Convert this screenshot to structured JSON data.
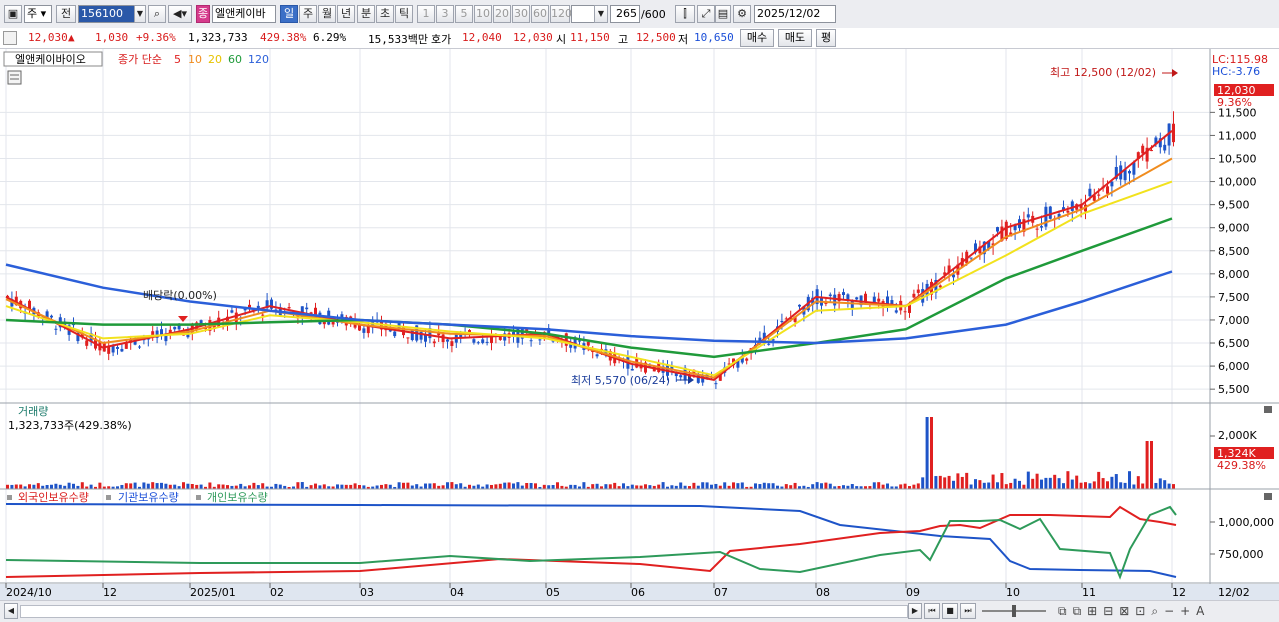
{
  "toolbar": {
    "mode": "주",
    "prev": "전",
    "code": "156100",
    "stock_name": "엘앤케이바",
    "badge": "종",
    "periods": [
      "일",
      "주",
      "월",
      "년",
      "분",
      "초",
      "틱"
    ],
    "selected_period": "일",
    "numbers": [
      "1",
      "3",
      "5",
      "10",
      "20",
      "30",
      "60",
      "120"
    ],
    "count": "265",
    "total": "/600",
    "date": "2025/12/02"
  },
  "quote": {
    "price": "12,030",
    "arrow": "▲",
    "change": "1,030",
    "rate": "+9.36%",
    "volume": "1,323,733",
    "vol_ratio": "429.38%",
    "turnover": "6.29%",
    "amount": "15,533백만",
    "ask_label": "호가",
    "ask": "12,040",
    "bid": "12,030",
    "open_label": "시",
    "open": "11,150",
    "high_label": "고",
    "high": "12,500",
    "low_label": "저",
    "low": "10,650",
    "buy": "매수",
    "sell": "매도",
    "eval": "평"
  },
  "price_panel": {
    "name": "엘앤케이바이오",
    "ma_title": "종가 단순",
    "ma_periods": [
      "5",
      "10",
      "20",
      "60",
      "120"
    ],
    "lc": "LC:115.98",
    "hc": "HC:-3.76",
    "current_price": "12,030",
    "current_rate": "9.36%",
    "high_note": "최고 12,500 (12/02)",
    "low_note": "최저 5,570 (06/24)",
    "dividend_note": "배당락(0.00%)",
    "y_ticks": [
      "11,500",
      "11,000",
      "10,500",
      "10,000",
      "9,500",
      "9,000",
      "8,500",
      "8,000",
      "7,500",
      "7,000",
      "6,500",
      "6,000",
      "5,500"
    ],
    "colors": {
      "ma5": "#e02020",
      "ma10": "#f08c1e",
      "ma20": "#f2e21d",
      "ma60": "#1f9a3a",
      "ma120": "#2b5fd9",
      "up": "#e02020",
      "down": "#1e54c8"
    }
  },
  "volume_panel": {
    "title": "거래량",
    "value": "1,323,733주(429.38%)",
    "tick": "2,000K",
    "current": "1,324K",
    "current_rate": "429.38%"
  },
  "holding_panel": {
    "series": [
      "외국인보유수량",
      "기관보유수량",
      "개인보유수량"
    ],
    "ticks": [
      "1,000,000",
      "750,000"
    ],
    "colors": {
      "foreign": "#e02020",
      "institution": "#1e54c8",
      "individual": "#2e9a5a"
    }
  },
  "x_axis": {
    "labels": [
      "2024/10",
      "12",
      "2025/01",
      "02",
      "03",
      "04",
      "05",
      "06",
      "07",
      "08",
      "09",
      "10",
      "11",
      "12"
    ],
    "right_label": "12/02"
  },
  "chart_data": {
    "type": "line",
    "title": "",
    "x": [
      "2024/10",
      "12",
      "2025/01",
      "02",
      "03",
      "04",
      "05",
      "06",
      "07",
      "08",
      "09",
      "10",
      "11",
      "12"
    ],
    "series": [
      {
        "name": "5",
        "values": [
          7500,
          6400,
          6800,
          7300,
          6900,
          6600,
          6700,
          6050,
          5700,
          7500,
          7300,
          9000,
          9500,
          11100
        ]
      },
      {
        "name": "10",
        "values": [
          7450,
          6500,
          6750,
          7200,
          6900,
          6700,
          6650,
          6100,
          5750,
          7400,
          7300,
          8800,
          9400,
          10500
        ]
      },
      {
        "name": "20",
        "values": [
          7300,
          6600,
          6700,
          7100,
          6950,
          6750,
          6600,
          6200,
          5800,
          7200,
          7300,
          8400,
          9300,
          10000
        ]
      },
      {
        "name": "60",
        "values": [
          7000,
          6900,
          6900,
          6950,
          7000,
          6900,
          6700,
          6400,
          6200,
          6500,
          6800,
          7900,
          8500,
          9200
        ]
      },
      {
        "name": "120",
        "values": [
          8200,
          7700,
          7400,
          7200,
          7000,
          6900,
          6800,
          6650,
          6550,
          6500,
          6600,
          6900,
          7400,
          8050
        ]
      }
    ],
    "ylim": [
      5200,
      12700
    ],
    "grid": true,
    "legend": "top-left"
  }
}
